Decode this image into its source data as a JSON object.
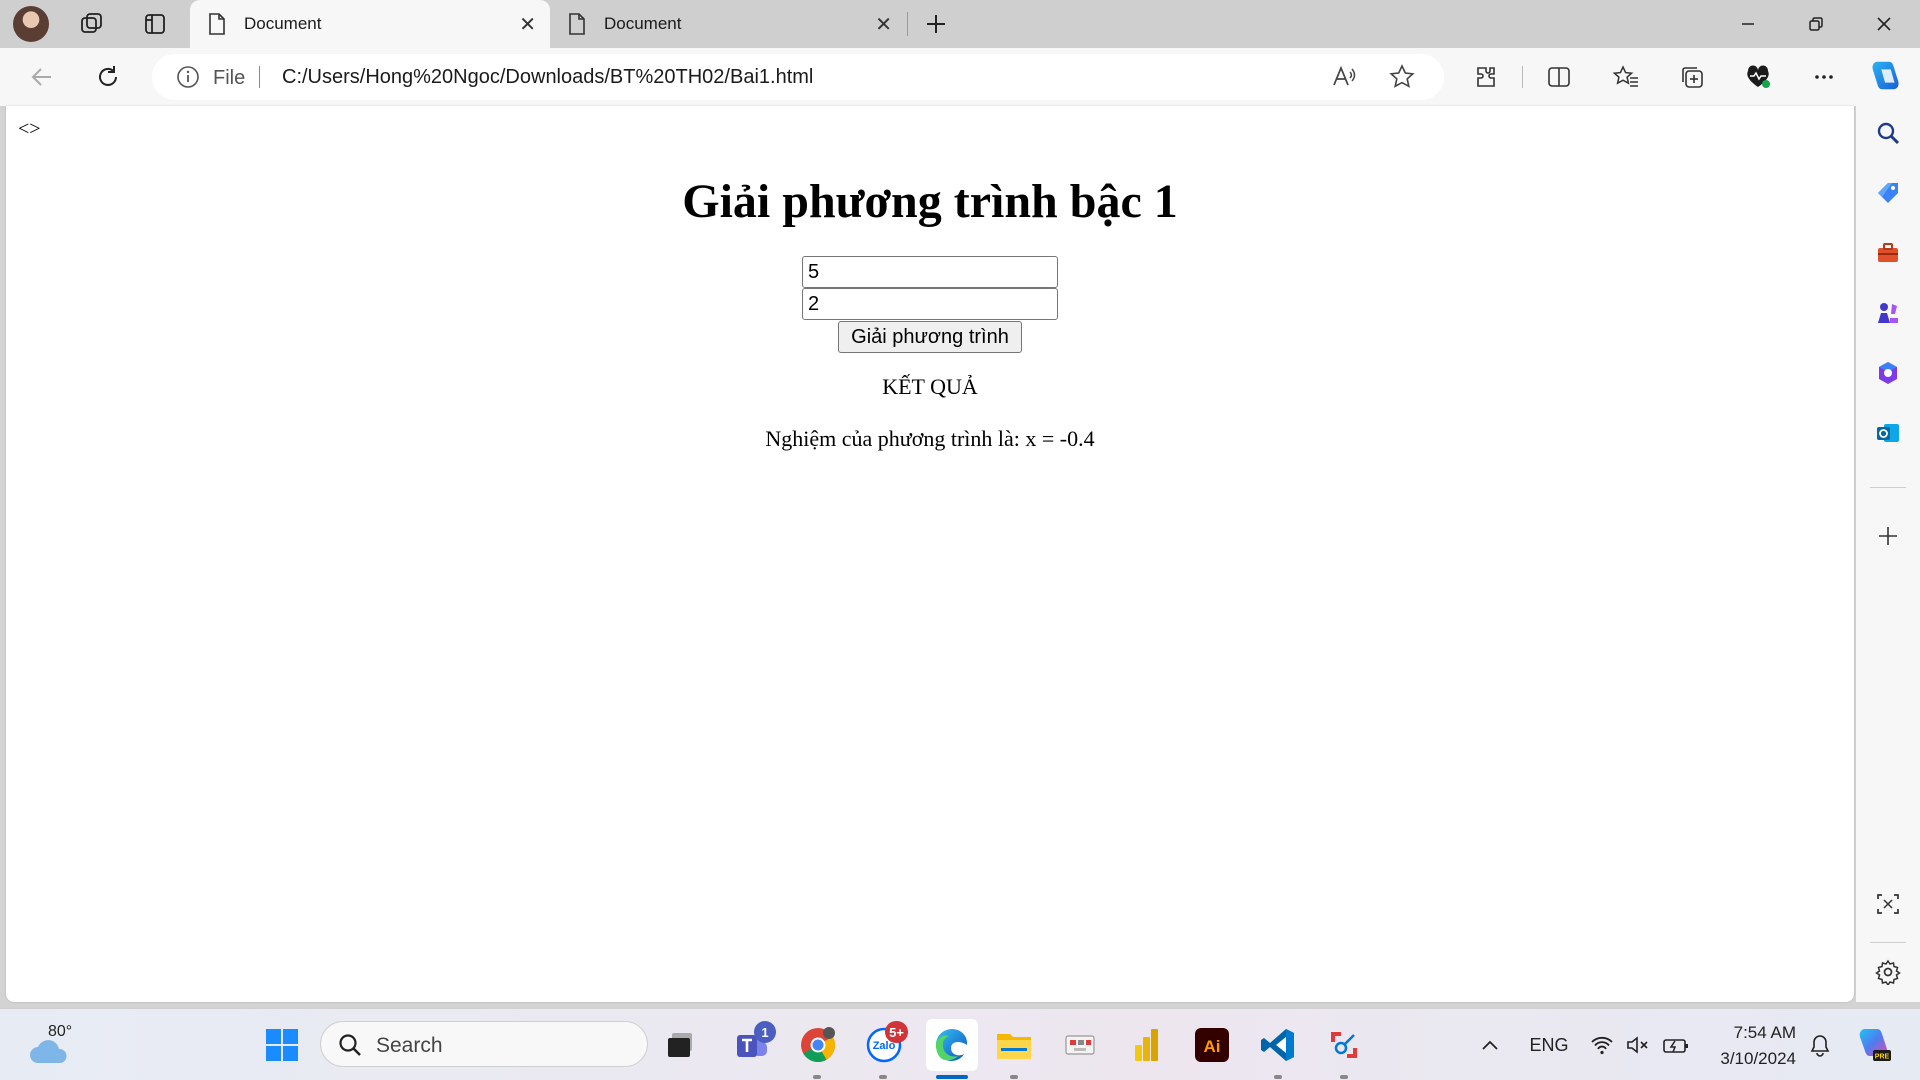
{
  "browser": {
    "tabs": [
      {
        "title": "Document",
        "active": true
      },
      {
        "title": "Document",
        "active": false
      }
    ],
    "address": {
      "scheme_label": "File",
      "url": "C:/Users/Hong%20Ngoc/Downloads/BT%20TH02/Bai1.html"
    }
  },
  "page": {
    "tagline": "<>",
    "title": "Giải phương trình bậc 1",
    "input_a": "5",
    "input_b": "2",
    "solve_button": "Giải phương trình",
    "result_label": "KẾT QUẢ",
    "result_text": "Nghiệm của phương trình là: x = -0.4"
  },
  "taskbar": {
    "weather_temp": "80°",
    "search_label": "Search",
    "teams_badge": "1",
    "zalo_badge": "5+",
    "language": "ENG",
    "time": "7:54 AM",
    "date": "3/10/2024"
  },
  "colors": {
    "accent": "#0078d4",
    "badge_red": "#d13438",
    "badge_blue": "#4a5fc1"
  }
}
